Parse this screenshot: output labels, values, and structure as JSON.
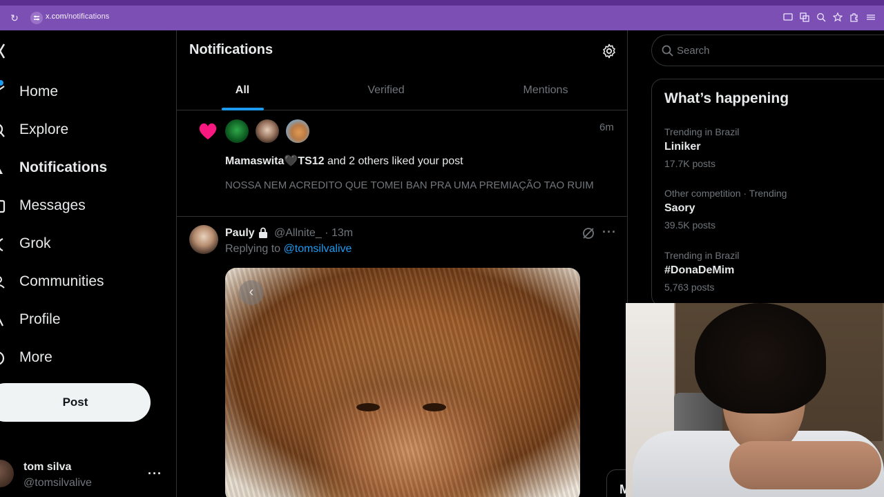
{
  "browser": {
    "url_host": "x.com",
    "url_path": "/notifications",
    "icons": [
      "reload-icon",
      "site-settings-icon",
      "cast-icon",
      "translate-icon",
      "zoom-icon",
      "bookmark-star-icon",
      "extensions-icon"
    ]
  },
  "sidebar": {
    "items": [
      {
        "label": "Home",
        "icon": "home-icon"
      },
      {
        "label": "Explore",
        "icon": "explore-icon"
      },
      {
        "label": "Notifications",
        "icon": "bell-icon",
        "active": true
      },
      {
        "label": "Messages",
        "icon": "envelope-icon"
      },
      {
        "label": "Grok",
        "icon": "grok-icon"
      },
      {
        "label": "Communities",
        "icon": "communities-icon"
      },
      {
        "label": "Profile",
        "icon": "person-icon"
      },
      {
        "label": "More",
        "icon": "more-circle-icon"
      }
    ],
    "post_label": "Post",
    "account": {
      "name": "tom silva",
      "handle": "@tomsilvalive",
      "more": "···"
    }
  },
  "main": {
    "title": "Notifications",
    "tabs": [
      {
        "label": "All",
        "active": true
      },
      {
        "label": "Verified"
      },
      {
        "label": "Mentions"
      }
    ],
    "notification": {
      "time": "6m",
      "user_bold": "Mamaswita🖤TS12",
      "rest": " and 2 others liked your post",
      "post_text": "NOSSA NEM ACREDITO QUE TOMEI BAN PRA UMA PREMIAÇÃO TAO RUIM"
    },
    "reply": {
      "name": "Pauly",
      "handle_time": "@Allnite_ · 13m",
      "replying_prefix": "Replying to ",
      "replying_to": "@tomsilvalive",
      "more": "···",
      "media_prev": "‹"
    }
  },
  "right": {
    "search_placeholder": "Search",
    "trends_title": "What’s happening",
    "trends": [
      {
        "context": "Trending in Brazil",
        "name": "Liniker",
        "count": "17.7K posts"
      },
      {
        "context": "Other competition · Trending",
        "name": "Saory",
        "count": "39.5K posts"
      },
      {
        "context": "Trending in Brazil",
        "name": "#DonaDeMim",
        "count": "5,763 posts"
      }
    ]
  },
  "messages_tab": "M",
  "colors": {
    "accent": "#1d9bf0",
    "heart": "#f91880",
    "browser_bar": "#7c4fb4"
  }
}
